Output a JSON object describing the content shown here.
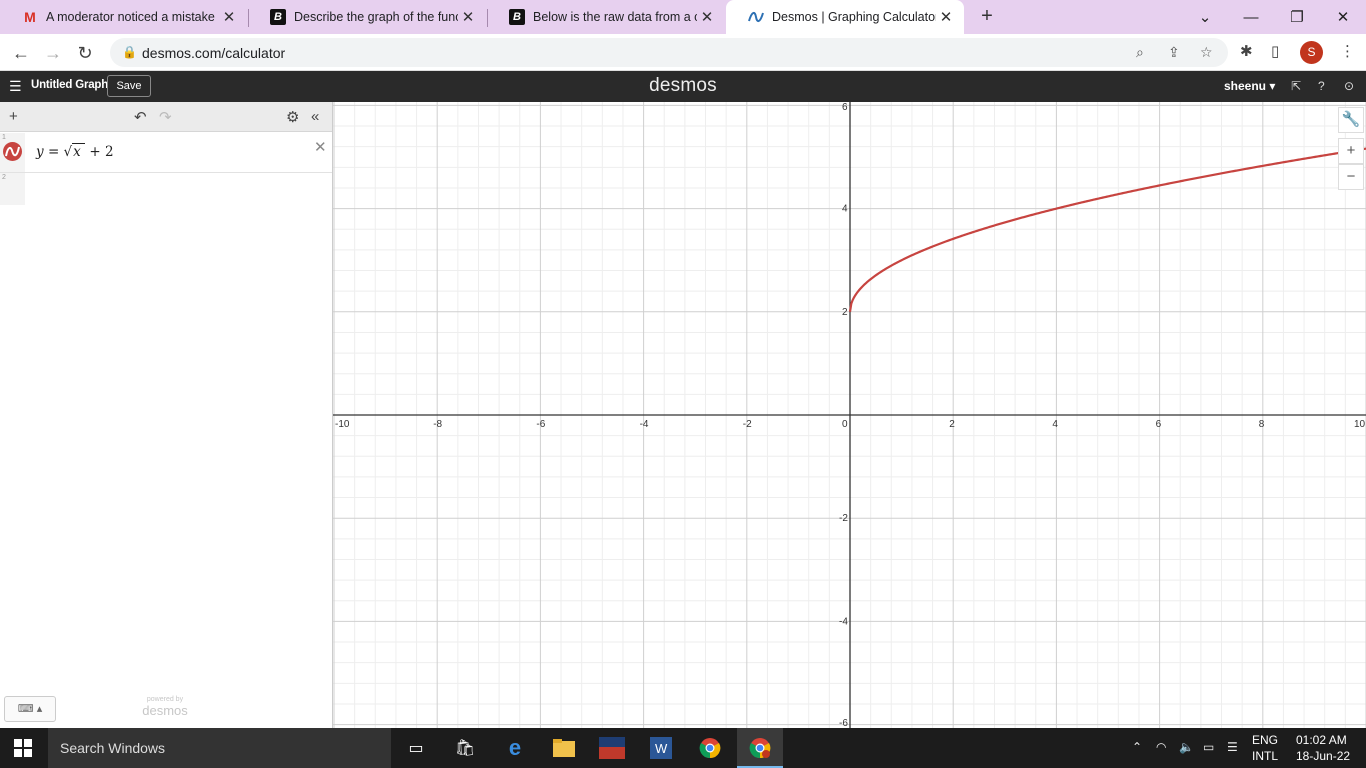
{
  "browser": {
    "tabs": [
      {
        "title": "A moderator noticed a mistake in",
        "icon": "gmail-icon",
        "active": false
      },
      {
        "title": "Describe the graph of the functio",
        "icon": "brainly-icon",
        "active": false
      },
      {
        "title": "Below is the raw data from a cent",
        "icon": "brainly-icon",
        "active": false
      },
      {
        "title": "Desmos | Graphing Calculator",
        "icon": "desmos-icon",
        "active": true
      }
    ],
    "url": "desmos.com/calculator",
    "profile_initial": "S"
  },
  "desmos": {
    "graph_title": "Untitled Graph",
    "save_label": "Save",
    "logo": "desmos",
    "user": "sheenu",
    "expressions": [
      {
        "index": "1",
        "latex_parts": {
          "y": "y",
          "eq": "=",
          "x": "x",
          "rest": "+ 2"
        },
        "color": "#c74440"
      },
      {
        "index": "2"
      }
    ],
    "powered_by_label": "powered by",
    "powered_by_brand": "desmos",
    "curve_color": "#c74440"
  },
  "graph": {
    "x_ticks": [
      "-10",
      "-8",
      "-6",
      "-4",
      "-2",
      "0",
      "2",
      "4",
      "6",
      "8",
      "10"
    ],
    "y_ticks": [
      "6",
      "4",
      "2",
      "-2",
      "-4",
      "-6"
    ],
    "xlim": [
      -10,
      10
    ],
    "ylim": [
      -6,
      6
    ],
    "function": "sqrt(x) + 2"
  },
  "taskbar": {
    "search_placeholder": "Search Windows",
    "lang_line1": "ENG",
    "lang_line2": "INTL",
    "time": "01:02 AM",
    "date": "18-Jun-22"
  }
}
